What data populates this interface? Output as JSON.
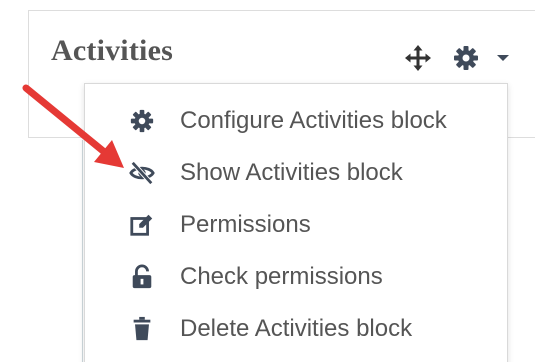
{
  "block": {
    "title": "Activities",
    "move_icon": "move-arrows-icon",
    "actions_icon": "gear-icon",
    "caret_icon": "caret-down-icon"
  },
  "menu": {
    "items": [
      {
        "label": "Configure Activities block",
        "icon": "gear-icon"
      },
      {
        "label": "Show Activities block",
        "icon": "eye-slash-icon"
      },
      {
        "label": "Permissions",
        "icon": "edit-square-icon"
      },
      {
        "label": "Check permissions",
        "icon": "unlock-icon"
      },
      {
        "label": "Delete Activities block",
        "icon": "trash-icon"
      }
    ]
  },
  "colors": {
    "text": "#555555",
    "icon": "#3f4a5a",
    "annotation_arrow": "#e53935",
    "hover_bg": "#f1f3f5"
  }
}
